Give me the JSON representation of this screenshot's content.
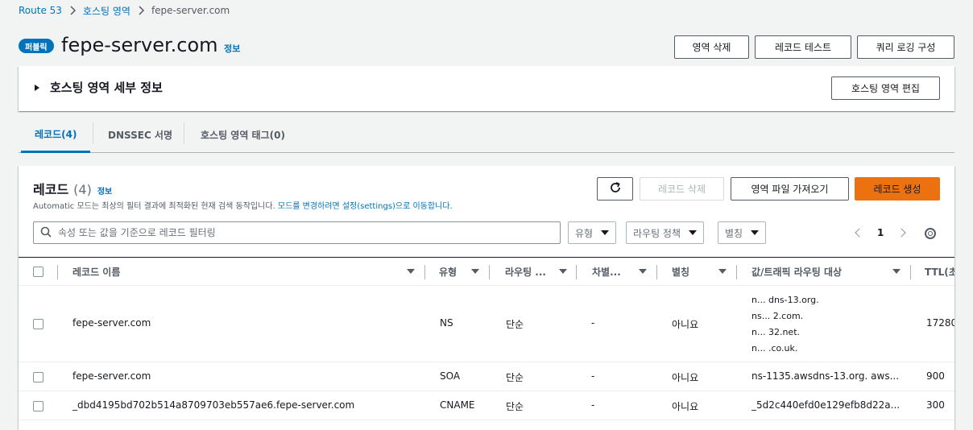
{
  "breadcrumb": {
    "items": [
      "Route 53",
      "호스팅 영역",
      "fepe-server.com"
    ]
  },
  "header": {
    "badge": "퍼블릭",
    "title": "fepe-server.com",
    "info": "정보",
    "buttons": {
      "delete_zone": "영역 삭제",
      "test_record": "레코드 테스트",
      "query_logging": "쿼리 로깅 구성"
    }
  },
  "details": {
    "title": "호스팅 영역 세부 정보",
    "edit_button": "호스팅 영역 편집"
  },
  "tabs": [
    {
      "label": "레코드(4)",
      "active": true
    },
    {
      "label": "DNSSEC 서명",
      "active": false
    },
    {
      "label": "호스팅 영역 태그(0)",
      "active": false
    }
  ],
  "records": {
    "title": "레코드",
    "count": "(4)",
    "info": "정보",
    "description": "Automatic 모드는 최상의 필터 결과에 최적화된 현재 검색 동작입니다.",
    "description_link": "모드를 변경하려면 설정(settings)으로 이동합니다.",
    "buttons": {
      "delete": "레코드 삭제",
      "import": "영역 파일 가져오기",
      "create": "레코드 생성"
    },
    "filter_placeholder": "속성 또는 값을 기준으로 레코드 필터링",
    "filters": {
      "type": "유형",
      "routing": "라우팅 정책",
      "alias": "별칭"
    },
    "page": "1",
    "columns": [
      "레코드 이름",
      "유형",
      "라우팅 ...",
      "차별...",
      "별칭",
      "값/트래픽 라우팅 대상",
      "TTL(초"
    ],
    "rows": [
      {
        "name": "fepe-server.com",
        "type": "NS",
        "routing": "단순",
        "diff": "-",
        "alias": "아니요",
        "values": [
          "n...                dns-13.org.",
          "ns...               2.com.",
          "n...                32.net.",
          "n...                .co.uk."
        ],
        "ttl": "17280"
      },
      {
        "name": "fepe-server.com",
        "type": "SOA",
        "routing": "단순",
        "diff": "-",
        "alias": "아니요",
        "values": [
          "ns-1135.awsdns-13.org. aws..."
        ],
        "ttl": "900"
      },
      {
        "name": "_dbd4195bd702b514a8709703eb557ae6.fepe-server.com",
        "type": "CNAME",
        "routing": "단순",
        "diff": "-",
        "alias": "아니요",
        "values": [
          "_5d2c440efd0e129efb8d22a..."
        ],
        "ttl": "300"
      }
    ]
  },
  "colors": {
    "link": "#0073bb",
    "primary": "#ec7211",
    "badge": "#0073bb"
  }
}
